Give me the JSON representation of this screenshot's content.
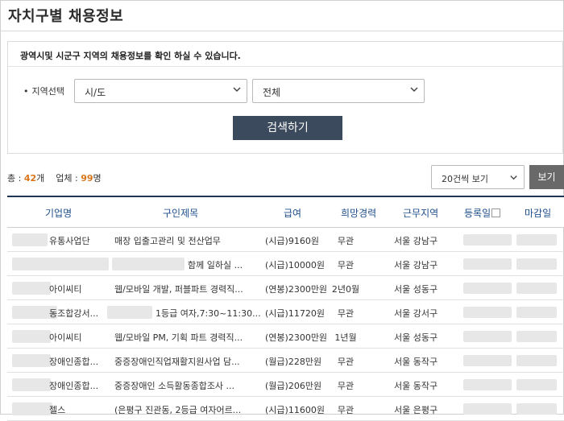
{
  "page": {
    "title": "자치구별 채용정보"
  },
  "filter": {
    "notice": "광역시및 시군구 지역의 채용정보를 확인 하실 수 있습니다.",
    "region_label": "지역선택",
    "region_bullet": "•",
    "sido_value": "시/도",
    "district_value": "전체",
    "search_button": "검색하기"
  },
  "summary": {
    "total_label": "총 : ",
    "total_count": "42",
    "total_unit": "개",
    "company_label": "업체 : ",
    "company_count": "99",
    "company_unit": "명"
  },
  "pagination": {
    "per_page_value": "20건씩 보기",
    "view_button": "보기"
  },
  "table": {
    "headers": {
      "company": "기업명",
      "title": "구인제목",
      "salary": "급여",
      "experience": "희망경력",
      "location": "근무지역",
      "registered": "등록일",
      "deadline": "마감일"
    },
    "rows": [
      {
        "company": "유통사업단",
        "title": "매장 입출고관리 및 전산업무",
        "salary": "(시급)9160원",
        "experience": "무관",
        "location": "서울 강남구"
      },
      {
        "company": "",
        "title": "함께 일하실 ...",
        "salary": "(시급)10000원",
        "experience": "무관",
        "location": "서울 강남구"
      },
      {
        "company": "아이씨티",
        "title": "웹/모바일 개발, 퍼블파트 경력직...",
        "salary": "(연봉)2300만원",
        "experience": "2년0월",
        "location": "서울 성동구"
      },
      {
        "company": "동조합강서...",
        "title": "1등급 여자,7:30~11:30...",
        "salary": "(시급)11720원",
        "experience": "무관",
        "location": "서울 강서구"
      },
      {
        "company": "아이씨티",
        "title": "웹/모바일 PM, 기획 파트 경력직...",
        "salary": "(연봉)2300만원",
        "experience": "1년월",
        "location": "서울 성동구"
      },
      {
        "company": "장애인종합...",
        "title": "중증장애인직업재활지원사업 담...",
        "salary": "(월급)228만원",
        "experience": "무관",
        "location": "서울 동작구"
      },
      {
        "company": "장애인종합...",
        "title": "중증장애인 소득활동종합조사 ...",
        "salary": "(월급)206만원",
        "experience": "무관",
        "location": "서울 동작구"
      },
      {
        "company": "젤스",
        "title": "(은평구 진관동, 2등급 여자어르...",
        "salary": "(시급)11600원",
        "experience": "무관",
        "location": "서울 은평구"
      }
    ]
  },
  "icons": {
    "dropdown": "chevron-down-icon",
    "sort": "sort-icon"
  },
  "colors": {
    "accent_count": "#d9761c",
    "header_text": "#1f4f8c",
    "header_rule": "#1f3553",
    "search_button": "#3b4a5c",
    "view_button": "#696969"
  }
}
